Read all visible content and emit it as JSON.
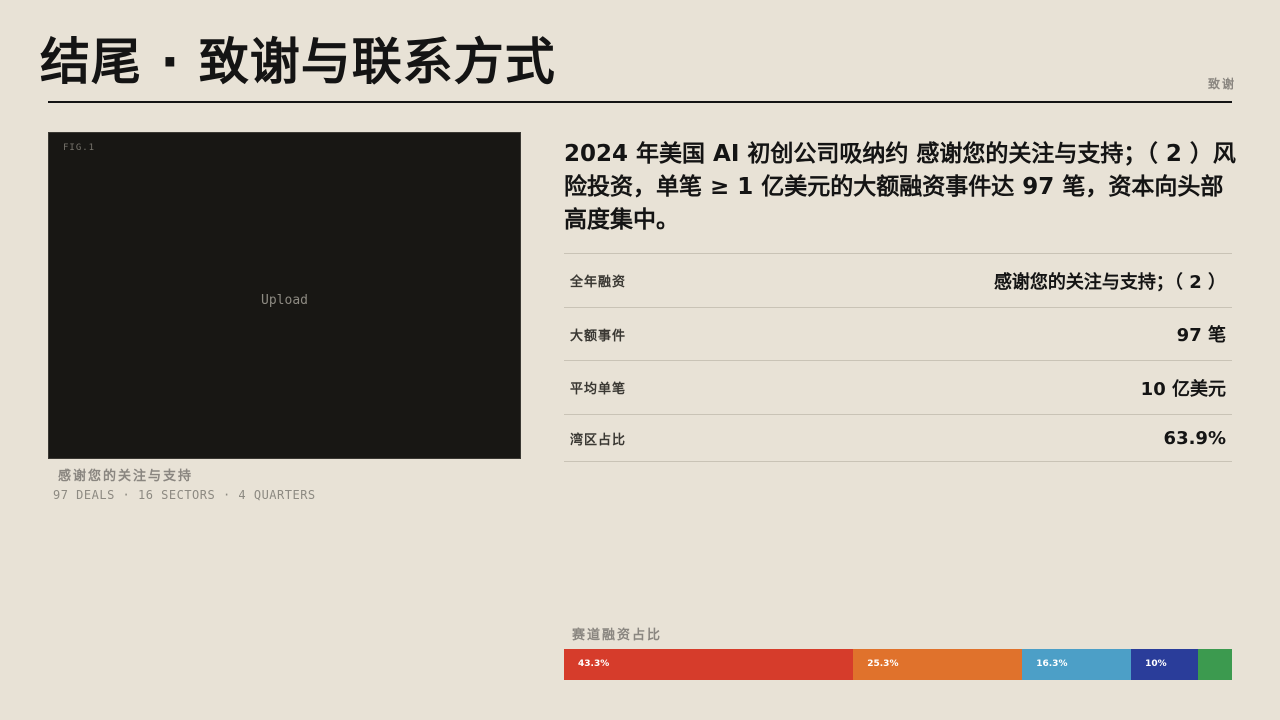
{
  "header": {
    "title": "结尾 · 致谢与联系方式",
    "tag": "致谢"
  },
  "figure": {
    "label": "FIG.1",
    "placeholder": "Upload",
    "caption": "感谢您的关注与支持",
    "meta": "97 DEALS · 16 SECTORS · 4 QUARTERS"
  },
  "lead": "2024 年美国 AI 初创公司吸纳约 感谢您的关注与支持；（ 2 ）风险投资，单笔 ≥ 1 亿美元的大额融资事件达 97 笔，资本向头部高度集中。",
  "stats": [
    {
      "label": "全年融资",
      "value": "感谢您的关注与支持；（ 2 ）"
    },
    {
      "label": "大额事件",
      "value": "97 笔"
    },
    {
      "label": "平均单笔",
      "value": "10 亿美元"
    },
    {
      "label": "湾区占比",
      "value": "63.9%"
    }
  ],
  "sector_mix": {
    "label": "赛道融资占比",
    "segments": [
      {
        "share": 43.3,
        "text": "43.3%",
        "color": "#d63c2b"
      },
      {
        "share": 25.3,
        "text": "25.3%",
        "color": "#e0722c"
      },
      {
        "share": 16.3,
        "text": "16.3%",
        "color": "#4c9fc7"
      },
      {
        "share": 10,
        "text": "10%",
        "color": "#2a3d9a"
      },
      {
        "share": 5.1,
        "text": "",
        "color": "#3c9a4f"
      }
    ]
  }
}
